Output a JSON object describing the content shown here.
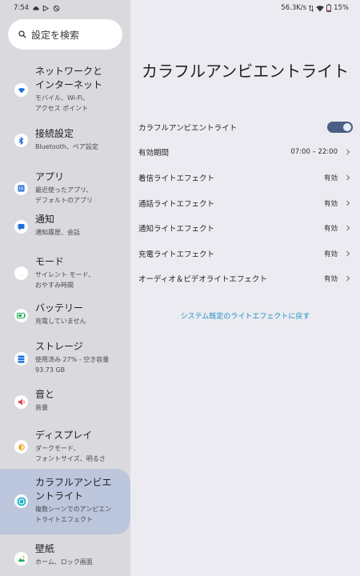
{
  "status_bar": {
    "time": "7:54",
    "network_speed": "56.3K/s",
    "battery": "15%"
  },
  "search": {
    "placeholder": "設定を検索"
  },
  "sidebar": {
    "items": [
      {
        "title": "ネットワークと\nインターネット",
        "subtitle": "モバイル、Wi-Fi、\nアクセス ポイント",
        "icon": "wifi-icon",
        "color": "#1f6fd9"
      },
      {
        "title": "接続設定",
        "subtitle": "Bluetooth、ペア設定",
        "icon": "bluetooth-icon",
        "color": "#1f6fd9"
      },
      {
        "title": "アプリ",
        "subtitle": "最近使ったアプリ、\nデフォルトのアプリ",
        "icon": "apps-icon",
        "color": "#1f6fd9"
      },
      {
        "title": "通知",
        "subtitle": "通知履歴、会話",
        "icon": "notification-icon",
        "color": "#1f6fd9"
      },
      {
        "title": "モード",
        "subtitle": "サイレント モード、\nおやすみ時間",
        "icon": "moon-icon",
        "color": "#4b3fb0"
      },
      {
        "title": "バッテリー",
        "subtitle": "充電していません",
        "icon": "battery-icon",
        "color": "#22b05a"
      },
      {
        "title": "ストレージ",
        "subtitle": "使用済み 27% - 空き容量\n93.73 GB",
        "icon": "storage-icon",
        "color": "#1f6fd9"
      },
      {
        "title": "音と",
        "subtitle": "音量",
        "icon": "speaker-icon",
        "color": "#e24a4a"
      },
      {
        "title": "ディスプレイ",
        "subtitle": "ダークモード、\nフォントサイズ、明るさ",
        "icon": "brightness-icon",
        "color": "#f0a81c"
      },
      {
        "title": "カラフルアンビエ\nントライト",
        "subtitle": "複数シーンでのアンビエン\nトライトエフェクト",
        "icon": "ambient-light-icon",
        "color": "#19b3c6"
      },
      {
        "title": "壁紙",
        "subtitle": "ホーム、ロック画面",
        "icon": "wallpaper-icon",
        "color": "#22b05a"
      }
    ]
  },
  "main": {
    "title": "カラフルアンビエントライト",
    "rows": [
      {
        "label": "カラフルアンビエントライト",
        "value": "",
        "type": "toggle",
        "on": true
      },
      {
        "label": "有効期間",
        "value": "07:00 – 22:00",
        "type": "link"
      },
      {
        "label": "着信ライトエフェクト",
        "value": "有効",
        "type": "link"
      },
      {
        "label": "通話ライトエフェクト",
        "value": "有効",
        "type": "link"
      },
      {
        "label": "通知ライトエフェクト",
        "value": "有効",
        "type": "link"
      },
      {
        "label": "充電ライトエフェクト",
        "value": "有効",
        "type": "link"
      },
      {
        "label": "オーディオ＆ビデオライトエフェクト",
        "value": "有効",
        "type": "link"
      }
    ],
    "reset_link": "システム既定のライトエフェクトに戻す"
  },
  "colors": {
    "accent": "#4a5e86",
    "link": "#1a8fbe",
    "active_item": "#bcc6dc"
  }
}
